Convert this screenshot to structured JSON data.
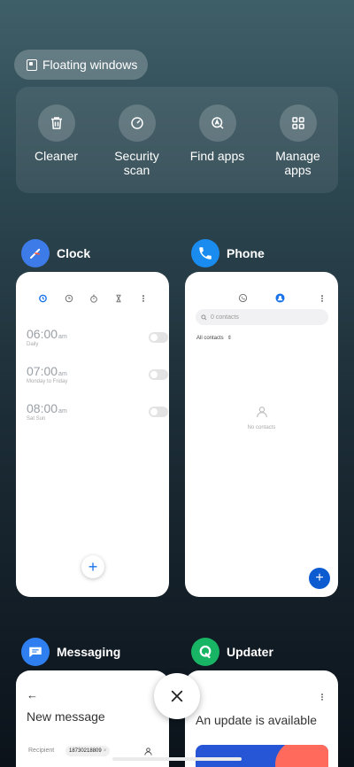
{
  "floating_windows": {
    "label": "Floating windows"
  },
  "tools": [
    {
      "label": "Cleaner",
      "icon": "trash-icon"
    },
    {
      "label": "Security\nscan",
      "icon": "security-scan-icon"
    },
    {
      "label": "Find apps",
      "icon": "find-apps-icon"
    },
    {
      "label": "Manage\napps",
      "icon": "grid-icon"
    }
  ],
  "apps": {
    "clock": {
      "name": "Clock",
      "alarms": [
        {
          "time": "06:00",
          "ampm": "am",
          "repeat": "Daily"
        },
        {
          "time": "07:00",
          "ampm": "am",
          "repeat": "Monday to Friday"
        },
        {
          "time": "08:00",
          "ampm": "am",
          "repeat": "Sat Sun"
        }
      ]
    },
    "phone": {
      "name": "Phone",
      "search_placeholder": "0 contacts",
      "filter": "All contacts",
      "empty_text": "No contacts"
    },
    "messaging": {
      "name": "Messaging",
      "title": "New message",
      "recipient_label": "Recipient",
      "recipient_value": "18730218809"
    },
    "updater": {
      "name": "Updater",
      "message": "An update is available"
    }
  },
  "colors": {
    "clock_icon_bg": "#3d7be8",
    "phone_icon_bg": "#1a8cf0",
    "messaging_icon_bg": "#2f7ff0",
    "updater_icon_bg": "#18b564",
    "accent_blue": "#0d5bd1"
  }
}
